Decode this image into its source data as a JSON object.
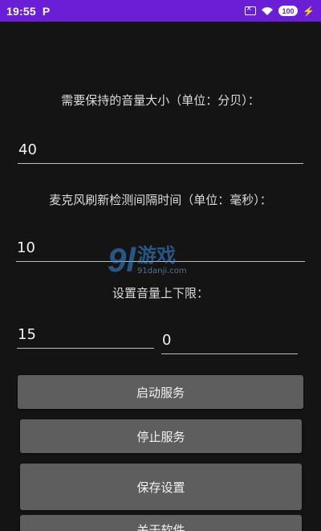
{
  "status_bar": {
    "time": "19:55",
    "app_badge": "P",
    "battery": "100",
    "icons": [
      "sim-off-icon",
      "wifi-icon",
      "battery-icon",
      "charging-bolt-icon"
    ]
  },
  "settings": {
    "volume_label": "需要保持的音量大小（单位：分贝）：",
    "volume_value": "40",
    "interval_label": "麦克风刷新检测间隔时间（单位：毫秒）：",
    "interval_value": "10",
    "limit_label": "设置音量上下限：",
    "upper_limit_value": "15",
    "lower_limit_value": "0"
  },
  "buttons": {
    "start_service": "启动服务",
    "stop_service": "停止服务",
    "save_settings": "保存设置",
    "close_app": "关于软件"
  },
  "watermark": {
    "num": "9l",
    "cn": "游戏",
    "url": "91danji.com"
  },
  "colors": {
    "status_bar": "#6a1fd6",
    "background": "#141414",
    "button": "#5e5e5e"
  }
}
